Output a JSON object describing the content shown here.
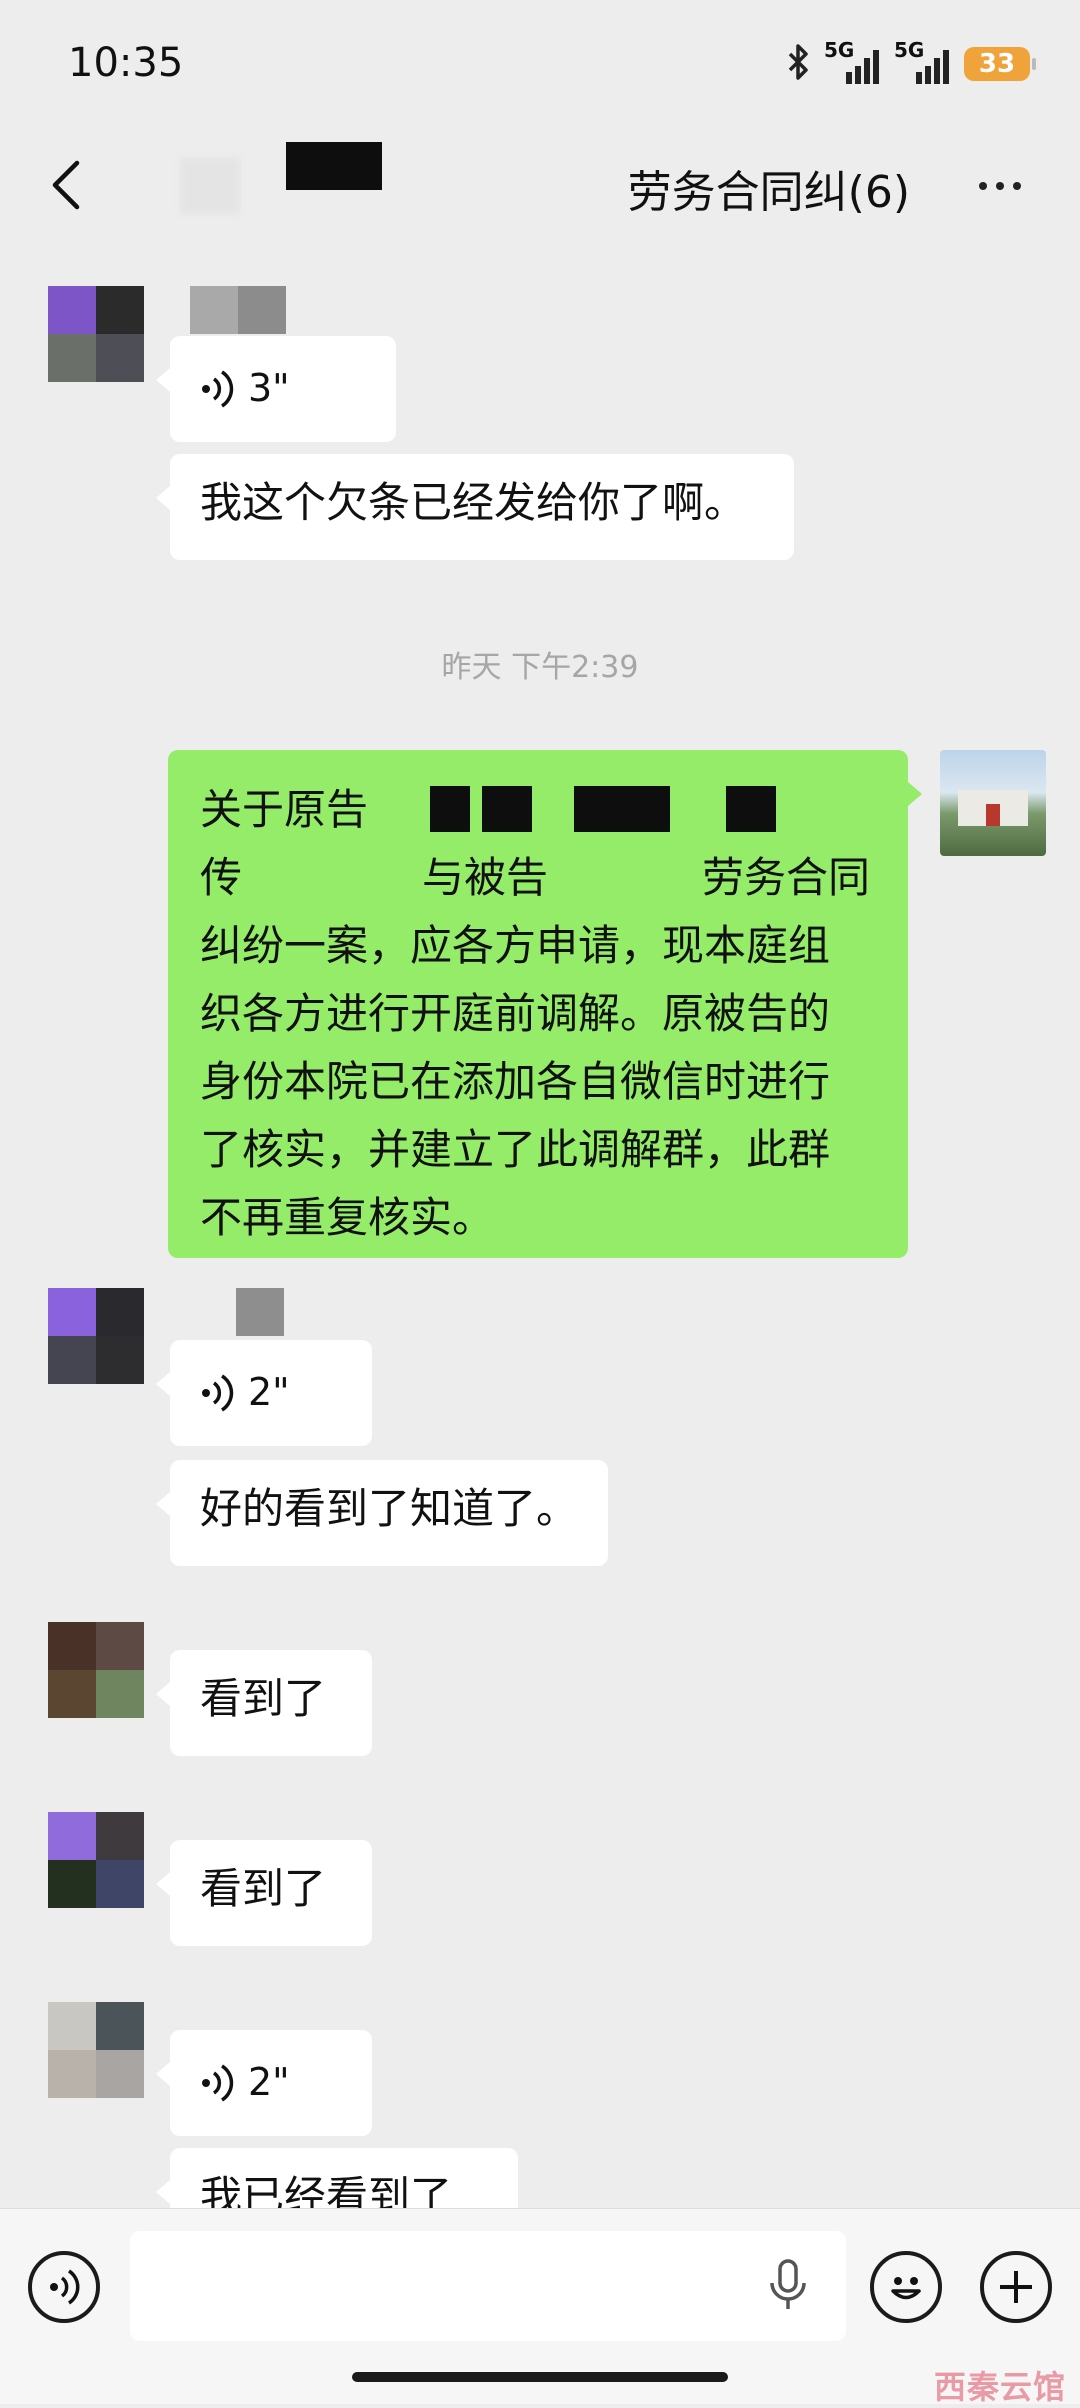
{
  "status_bar": {
    "time": "10:35",
    "signal1": "5G",
    "signal2": "5G",
    "battery": "33"
  },
  "header": {
    "title": "劳务合同纠(6)"
  },
  "messages": [
    {
      "type": "voice",
      "side": "left",
      "duration": "3\""
    },
    {
      "type": "text",
      "side": "left",
      "text": "我这个欠条已经发给你了啊。"
    },
    {
      "type": "timestamp",
      "text": "昨天 下午2:39"
    },
    {
      "type": "text",
      "side": "right",
      "lines": [
        "关于原告",
        "与被告",
        "劳务合同",
        "纠纷一案，应各方申请，现本庭组",
        "织各方进行开庭前调解。原被告的",
        "身份本院已在添加各自微信时进行",
        "了核实，并建立了此调解群，此群",
        "不再重复核实。"
      ],
      "line2_prefix": "传"
    },
    {
      "type": "voice",
      "side": "left",
      "duration": "2\""
    },
    {
      "type": "text",
      "side": "left",
      "text": "好的看到了知道了。"
    },
    {
      "type": "text",
      "side": "left",
      "text": "看到了"
    },
    {
      "type": "text",
      "side": "left",
      "text": "看到了"
    },
    {
      "type": "voice",
      "side": "left",
      "duration": "2\""
    },
    {
      "type": "text",
      "side": "left",
      "text": "我已经看到了"
    }
  ],
  "watermark": "西秦云馆",
  "icons": {
    "back": "chevron-left-icon",
    "more": "more-dots-icon",
    "voice_toggle": "voice-mode-icon",
    "mic": "microphone-icon",
    "emoji": "emoji-icon",
    "plus": "plus-icon",
    "voice_wave": "voice-wave-icon",
    "bluetooth": "bluetooth-icon",
    "signal": "signal-icon"
  }
}
